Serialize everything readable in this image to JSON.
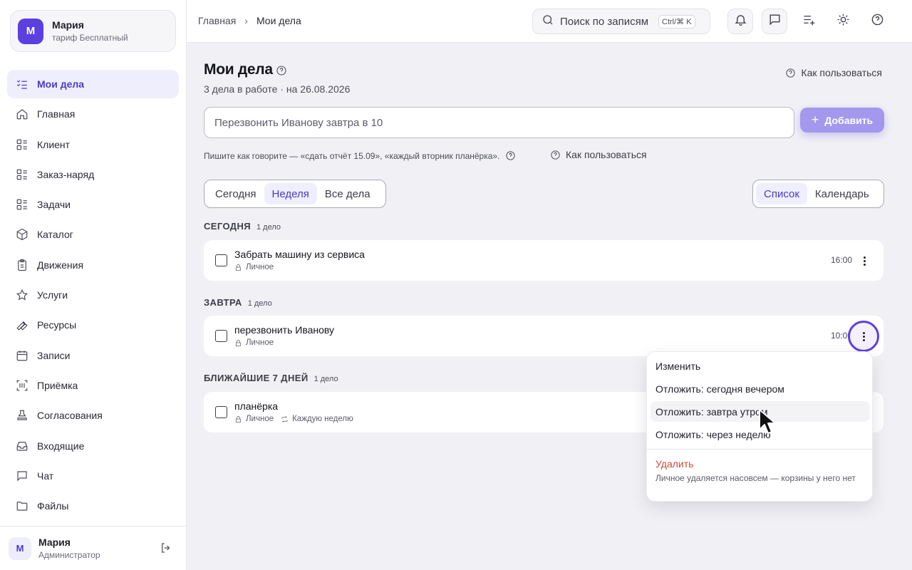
{
  "account": {
    "initial": "М",
    "name": "Мария",
    "plan": "тариф Бесплатный"
  },
  "sidebar": {
    "items": [
      {
        "label": "Мои дела",
        "icon": "checklist-icon",
        "active": true
      },
      {
        "label": "Главная",
        "icon": "home-icon"
      },
      {
        "label": "Клиент",
        "icon": "list-grid-icon"
      },
      {
        "label": "Заказ-наряд",
        "icon": "list-grid-icon"
      },
      {
        "label": "Задачи",
        "icon": "list-grid-icon"
      },
      {
        "label": "Каталог",
        "icon": "box-icon"
      },
      {
        "label": "Движения",
        "icon": "clipboard-icon"
      },
      {
        "label": "Услуги",
        "icon": "star-icon"
      },
      {
        "label": "Ресурсы",
        "icon": "wrench-icon"
      },
      {
        "label": "Записи",
        "icon": "calendar-icon"
      },
      {
        "label": "Приёмка",
        "icon": "scan-icon"
      },
      {
        "label": "Согласования",
        "icon": "stamp-icon"
      },
      {
        "label": "Входящие",
        "icon": "inbox-icon"
      },
      {
        "label": "Чат",
        "icon": "chat-icon"
      },
      {
        "label": "Файлы",
        "icon": "folder-icon"
      }
    ]
  },
  "user": {
    "initial": "М",
    "name": "Мария",
    "role": "Администратор"
  },
  "topbar": {
    "breadcrumb": [
      "Главная",
      "Мои дела"
    ],
    "search_placeholder": "Поиск по записям",
    "search_shortcut": "Ctrl/⌘ K"
  },
  "page": {
    "title": "Мои дела",
    "subtitle": "3 дела в работе · на 26.08.2026",
    "how_to": "Как пользоваться",
    "quick_input_placeholder": "Перезвонить Иванову завтра в 10",
    "add_label": "Добавить",
    "hint": "Пишите как говорите — «сдать отчёт 15.09», «каждый вторник планёрка».",
    "how_to_hint": "Как пользоваться"
  },
  "filters": {
    "period": [
      "Сегодня",
      "Неделя",
      "Все дела"
    ],
    "period_active": "Неделя",
    "view": [
      "Список",
      "Календарь"
    ],
    "view_active": "Список"
  },
  "sections": [
    {
      "title": "СЕГОДНЯ",
      "count": "1 дело",
      "tasks": [
        {
          "title": "Забрать машину из сервиса",
          "tag": "Личное",
          "time": "16:00"
        }
      ]
    },
    {
      "title": "ЗАВТРА",
      "count": "1 дело",
      "tasks": [
        {
          "title": "перезвонить Иванову",
          "tag": "Личное",
          "time": "10:00"
        }
      ]
    },
    {
      "title": "БЛИЖАЙШИЕ 7 ДНЕЙ",
      "count": "1 дело",
      "tasks": [
        {
          "title": "планёрка",
          "tag": "Личное",
          "repeat": "Каждую неделю"
        }
      ]
    }
  ],
  "menu": {
    "items": [
      "Изменить",
      "Отложить: сегодня вечером",
      "Отложить: завтра утром",
      "Отложить: через неделю"
    ],
    "hovered": "Отложить: завтра утром",
    "delete_label": "Удалить",
    "delete_note": "Личное удаляется насовсем — корзины у него нет"
  },
  "colors": {
    "accent": "#5b3fe0",
    "accent_soft": "#efeefc",
    "add_button": "#a397ee",
    "danger": "#d04a36"
  }
}
